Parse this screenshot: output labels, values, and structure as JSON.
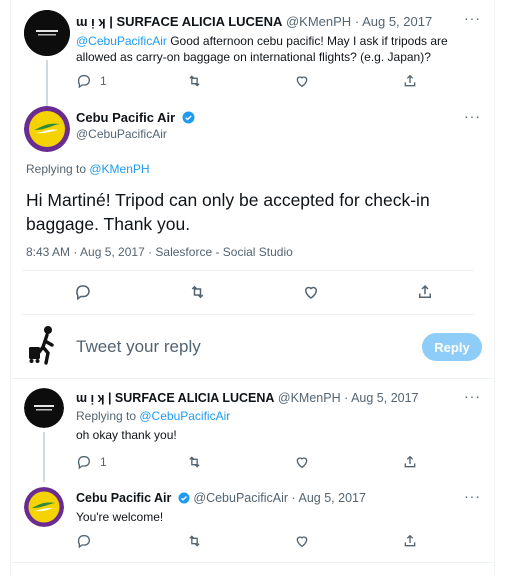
{
  "tweet1": {
    "display_name": "ɯ ᴉ ʞ | SURFACE ALICIA LUCENA",
    "handle": "@KMenPH",
    "sep": "·",
    "date": "Aug 5, 2017",
    "mention": "@CebuPacificAir",
    "text_a": " Good afternoon cebu pacific! May I ask if tripods are",
    "text_b": "allowed as carry-on baggage on international flights? (e.g. Japan)?",
    "reply_count": "1"
  },
  "main_tweet": {
    "display_name": "Cebu Pacific Air",
    "handle": "@CebuPacificAir",
    "replying_prefix": "Replying to ",
    "replying_to": "@KMenPH",
    "text_a": "Hi Martiné! Tripod can only be accepted for check-in",
    "text_b": "baggage. Thank you.",
    "meta": "8:43 AM · Aug 5, 2017 · Salesforce - Social Studio"
  },
  "composer": {
    "placeholder": "Tweet your reply",
    "button_label": "Reply"
  },
  "reply1": {
    "display_name": "ɯ ᴉ ʞ | SURFACE ALICIA LUCENA",
    "handle": "@KMenPH",
    "sep": "·",
    "date": "Aug 5, 2017",
    "replying_prefix": "Replying to ",
    "replying_to": "@CebuPacificAir",
    "text": "oh okay thank you!",
    "reply_count": "1"
  },
  "reply2": {
    "display_name": "Cebu Pacific Air",
    "handle": "@CebuPacificAir",
    "sep": "·",
    "date": "Aug 5, 2017",
    "text": "You're welcome!"
  },
  "colors": {
    "link": "#1d9bf0",
    "verified": "#1d9bf0",
    "muted": "#536471",
    "reply_button": "#8ecdf8",
    "cebu_ring": "#6b2c91",
    "cebu_yellow": "#f5d300"
  },
  "icons": [
    "reply-icon",
    "retweet-icon",
    "like-icon",
    "share-icon",
    "more-icon",
    "verified-badge-icon",
    "traveler-avatar-icon"
  ]
}
